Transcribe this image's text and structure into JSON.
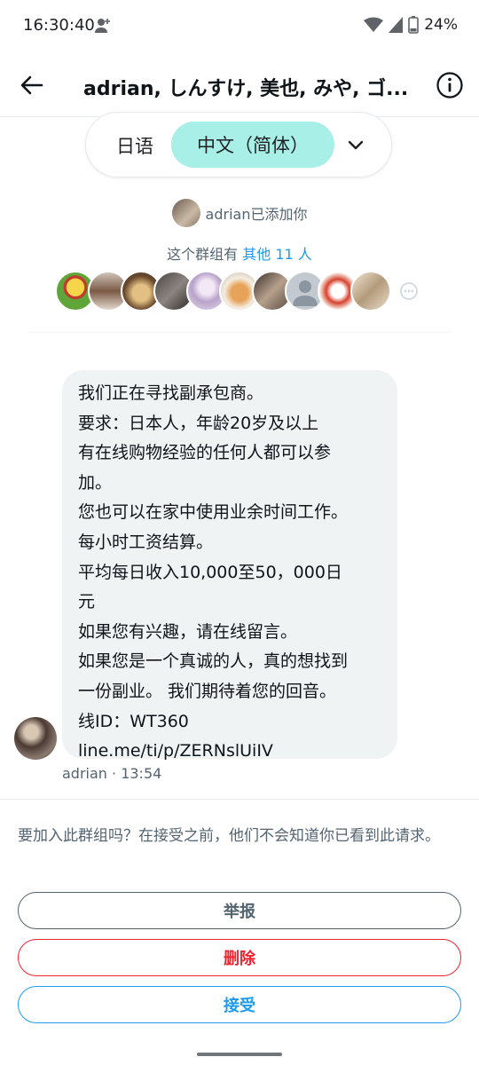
{
  "status_bar": {
    "time": "16:30:40",
    "battery": "24%"
  },
  "header": {
    "title": "adrian, しんすけ, 美也, みや, ゴ..."
  },
  "translation": {
    "source_lang": "日语",
    "target_lang": "中文（简体）"
  },
  "notice": {
    "added_text": "adrian已添加你",
    "group_prefix": "这个群组有 ",
    "group_link": "其他 11 人"
  },
  "message": {
    "lines": [
      "我们正在寻找副承包商。",
      "要求：日本人，年龄20岁及以上",
      "有在线购物经验的任何人都可以参",
      "加。",
      "您也可以在家中使用业余时间工作。",
      "每小时工资结算。",
      "平均每日收入10,000至50，000日",
      "元",
      "如果您有兴趣，请在线留言。",
      "如果您是一个真诚的人，真的想找到",
      "一份副业。 我们期待着您的回音。",
      "线ID：WT360",
      "line.me/ti/p/ZERNslUiIV"
    ],
    "meta": "adrian · 13:54"
  },
  "join": {
    "prompt": "要加入此群组吗？在接受之前，他们不会知道你已看到此请求。"
  },
  "actions": {
    "report": "举报",
    "delete": "删除",
    "accept": "接受"
  },
  "colors": {
    "accent": "#1d9bf0",
    "danger": "#f4212e",
    "pill_highlight": "#a8efe7",
    "bubble": "#eff3f4"
  }
}
